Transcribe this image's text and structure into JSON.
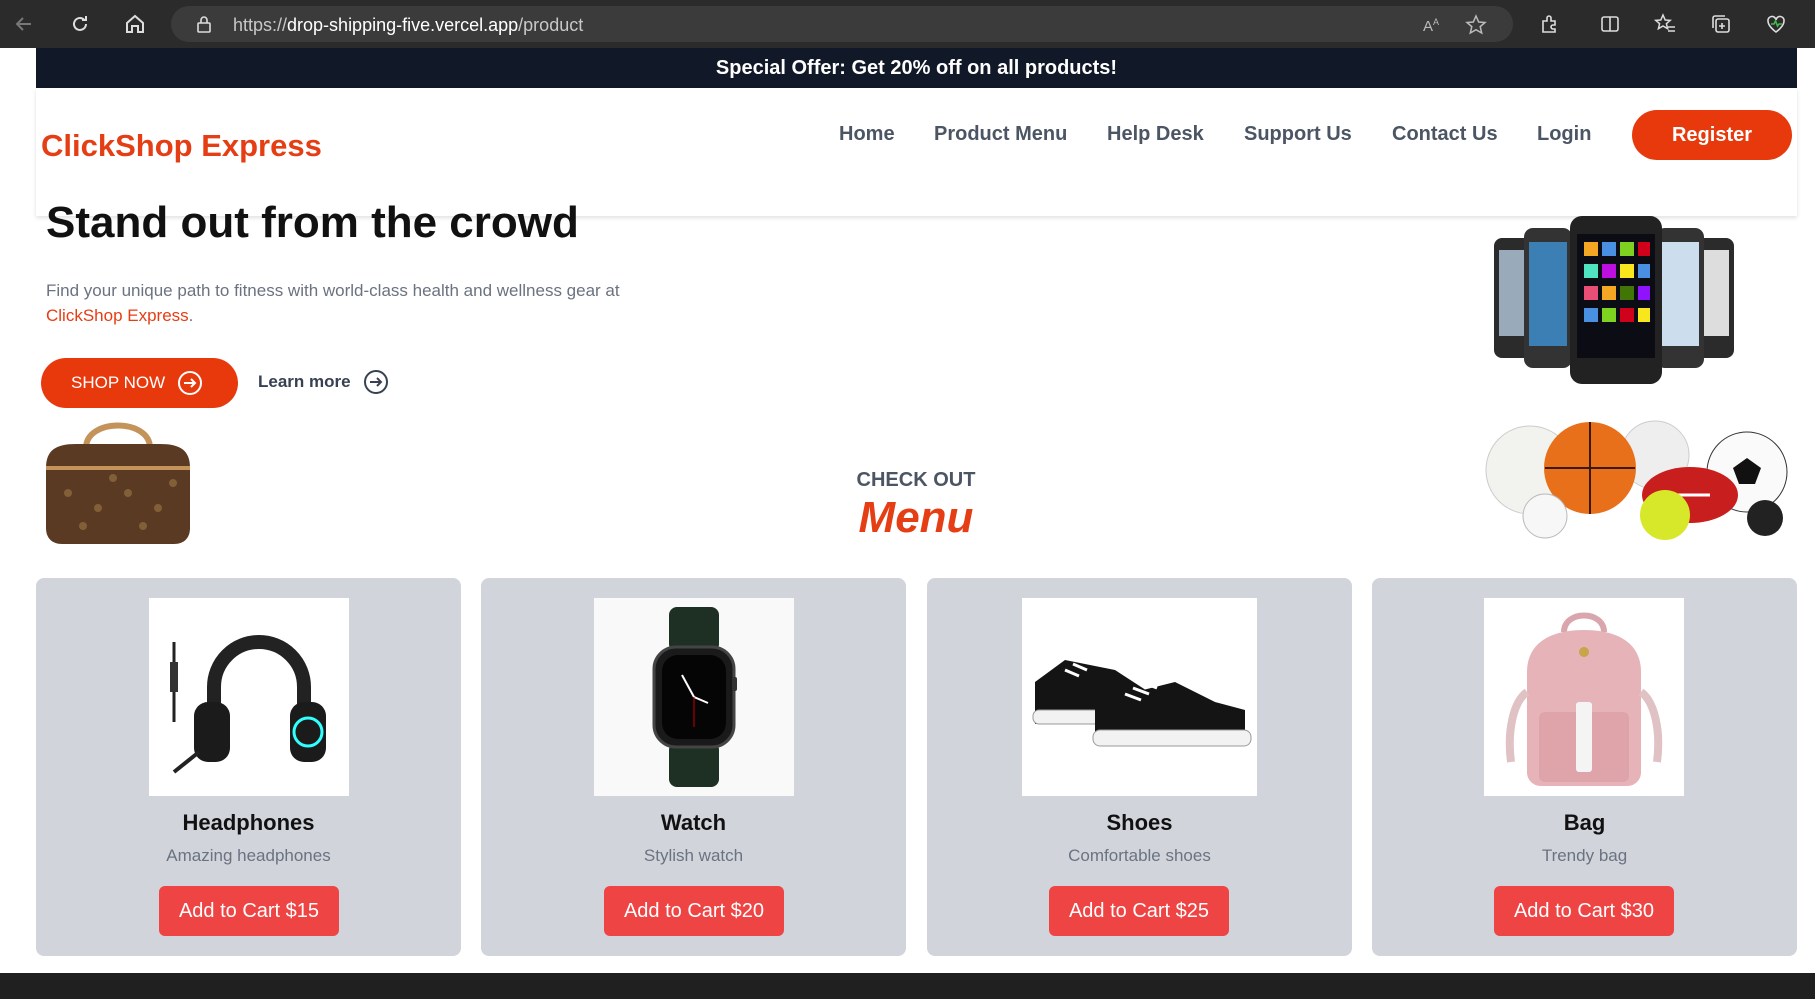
{
  "browser": {
    "url_scheme": "https://",
    "url_host": "drop-shipping-five.vercel.app",
    "url_path": "/product"
  },
  "offer_banner": "Special Offer: Get 20% off on all products!",
  "nav": {
    "brand": "ClickShop Express",
    "links": [
      "Home",
      "Product Menu",
      "Help Desk",
      "Support Us",
      "Contact Us",
      "Login"
    ],
    "register": "Register"
  },
  "hero": {
    "title": "Stand out from the crowd",
    "text": "Find your unique path to fitness with world-class health and wellness gear at",
    "text_accent": "ClickShop Express",
    "text_end": ".",
    "shop_now": "SHOP NOW",
    "learn_more": "Learn more"
  },
  "menu_section": {
    "kicker": "CHECK OUT",
    "title": "Menu"
  },
  "products": [
    {
      "name": "Headphones",
      "desc": "Amazing headphones",
      "button": "Add to Cart $15"
    },
    {
      "name": "Watch",
      "desc": "Stylish watch",
      "button": "Add to Cart $20"
    },
    {
      "name": "Shoes",
      "desc": "Comfortable shoes",
      "button": "Add to Cart $25"
    },
    {
      "name": "Bag",
      "desc": "Trendy bag",
      "button": "Add to Cart $30"
    }
  ],
  "colors": {
    "accent": "#e8390d",
    "banner": "#111827",
    "card": "#d1d5db",
    "cart_button": "#ef4444"
  },
  "icons": [
    "back-icon",
    "reload-icon",
    "home-icon",
    "lock-icon",
    "read-aloud-icon",
    "star-icon",
    "extensions-icon",
    "split-screen-icon",
    "favorites-icon",
    "collections-icon",
    "health-icon",
    "arrow-right-circle-icon"
  ]
}
